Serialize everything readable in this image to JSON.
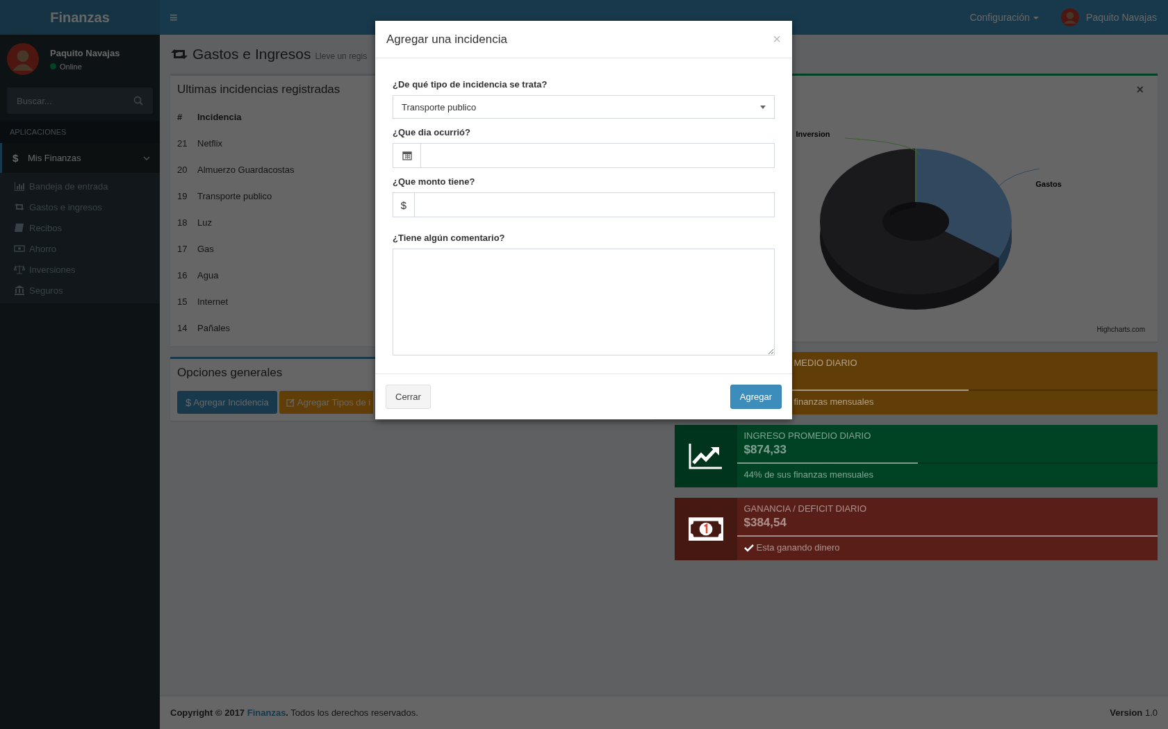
{
  "header": {
    "logo": "Finanzas",
    "menu_icon": "≡",
    "settings": "Configuración",
    "user": "Paquito Navajas"
  },
  "sidebar": {
    "user": {
      "name": "Paquito Navajas",
      "status": "Online"
    },
    "search": {
      "placeholder": "Buscar..."
    },
    "section": "APLICACIONES",
    "menu": {
      "icon": "$",
      "label": "Mis Finanzas",
      "selected": true,
      "expanded": true,
      "items": [
        {
          "label": "Bandeja de entrada",
          "kind": "chart"
        },
        {
          "label": "Gastos e ingresos",
          "kind": "exchange"
        },
        {
          "label": "Recibos",
          "kind": "book"
        },
        {
          "label": "Ahorro",
          "kind": "money"
        },
        {
          "label": "Inversiones",
          "kind": "balance"
        },
        {
          "label": "Seguros",
          "kind": "bank"
        }
      ]
    }
  },
  "page": {
    "title": "Gastos e Ingresos",
    "subtitle": "Lleve un regis"
  },
  "incidents": {
    "title": "Ultimas incidencias registradas",
    "columns": [
      "#",
      "Incidencia"
    ],
    "rows": [
      [
        "21",
        "Netflix"
      ],
      [
        "20",
        "Almuerzo Guardacostas"
      ],
      [
        "19",
        "Transporte publico"
      ],
      [
        "18",
        "Luz"
      ],
      [
        "17",
        "Gas"
      ],
      [
        "16",
        "Agua"
      ],
      [
        "15",
        "Internet"
      ],
      [
        "14",
        "Pañales"
      ]
    ]
  },
  "options": {
    "title": "Opciones generales",
    "buttons": [
      {
        "icon": "$",
        "label": "Agregar Incidencia",
        "kind": "primary"
      },
      {
        "label": "Agregar Tipos de i",
        "kind": "warning"
      }
    ]
  },
  "chart": {
    "close": "×",
    "labels": [
      "Inversion",
      "Gastos"
    ],
    "credit": "Highcharts.com"
  },
  "stats": [
    {
      "kind": "covered",
      "color": "#613e07",
      "label": "MEDIO DIARIO",
      "level": 0.55,
      "note": "finanzas mensuales"
    },
    {
      "kind": "trend",
      "color": "#004224",
      "label": "INGRESO PROMEDIO DIARIO",
      "value": "$874,33",
      "level": 0.43,
      "note": "44% de sus finanzas mensuales"
    },
    {
      "kind": "cash",
      "color": "#581e17",
      "label": "GANANCIA / DEFICIT DIARIO",
      "value": "$384,54",
      "level": 1,
      "note": "Esta ganando dinero"
    }
  ],
  "footer": {
    "copyright": "Copyright © 2017",
    "link": "Finanzas",
    "rest": "**.** Todos los derechos reservados.",
    "version": "**Version** 1.0"
  },
  "modal": {
    "title": "Agregar una incidencia",
    "close": "×",
    "type": {
      "label": "¿De qué tipo de incidencia se trata?",
      "value": "Transporte publico"
    },
    "date": {
      "label": "¿Que dia ocurrió?"
    },
    "amount": {
      "label": "¿Que monto tiene?",
      "addon": "$"
    },
    "comment": {
      "label": "¿Tiene algún comentario?"
    },
    "buttons": {
      "cancel": "Cerrar",
      "submit": "Agregar"
    }
  }
}
